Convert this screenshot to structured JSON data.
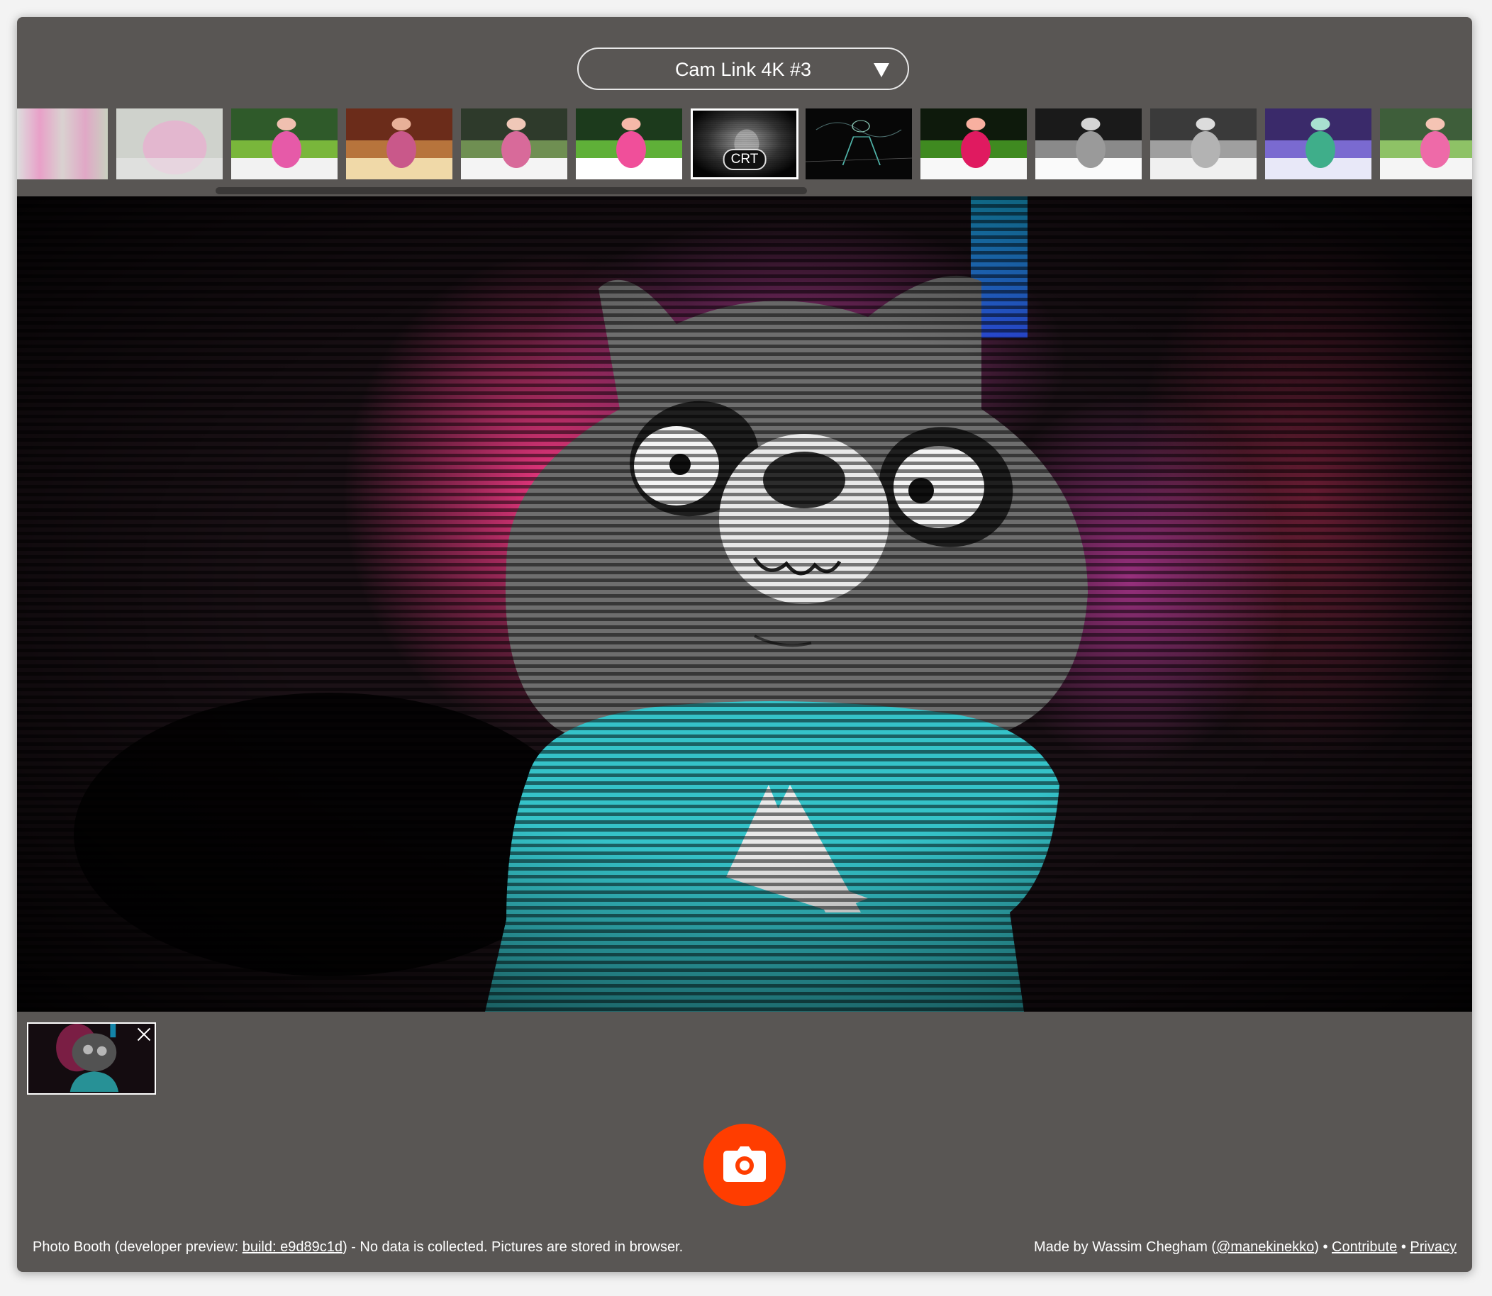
{
  "camera": {
    "selected": "Cam Link 4K #3"
  },
  "filters": {
    "selected_label": "CRT"
  },
  "footer": {
    "app_name": "Photo Booth (developer preview: ",
    "build_link": "build: e9d89c1d",
    "notice": ") - No data is collected. Pictures are stored in browser.",
    "made_by": "Made by Wassim Chegham (",
    "author_handle": "@manekinekko",
    "paren_close": ") • ",
    "contribute": "Contribute",
    "separator": " • ",
    "privacy": "Privacy"
  },
  "icons": {
    "camera_select": "chevron-down-icon",
    "shutter": "camera-icon",
    "remove_photo": "close-icon"
  },
  "colors": {
    "app_background": "#595654",
    "shutter": "#ff3d00",
    "shirt": "#35c2c8"
  }
}
